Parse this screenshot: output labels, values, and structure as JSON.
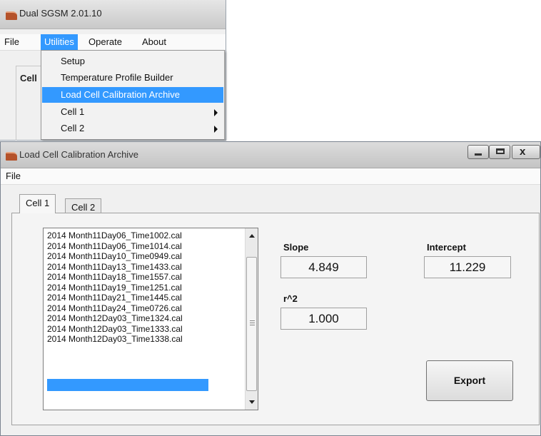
{
  "main_window": {
    "title": "Dual SGSM 2.01.10",
    "menu": [
      "File",
      "Utilities",
      "Operate",
      "About"
    ],
    "background_label": "Cell",
    "utilities_menu": [
      {
        "label": "Setup",
        "submenu": false
      },
      {
        "label": "Temperature Profile Builder",
        "submenu": false
      },
      {
        "label": "Load Cell Calibration Archive",
        "submenu": false,
        "highlighted": true
      },
      {
        "label": "Cell 1",
        "submenu": true
      },
      {
        "label": "Cell 2",
        "submenu": true
      }
    ]
  },
  "archive_window": {
    "title": "Load Cell Calibration Archive",
    "menu": [
      "File"
    ],
    "tabs": [
      "Cell 1",
      "Cell 2"
    ],
    "files": [
      "2014 Month11Day06_Time1002.cal",
      "2014 Month11Day06_Time1014.cal",
      "2014 Month11Day10_Time0949.cal",
      "2014 Month11Day13_Time1433.cal",
      "2014 Month11Day18_Time1557.cal",
      "2014 Month11Day19_Time1251.cal",
      "2014 Month11Day21_Time1445.cal",
      "2014 Month11Day24_Time0726.cal",
      "2014 Month12Day03_Time1324.cal",
      "2014 Month12Day03_Time1333.cal",
      "2014 Month12Day03_Time1338.cal"
    ],
    "slope_label": "Slope",
    "slope_value": "4.849",
    "intercept_label": "Intercept",
    "intercept_value": "11.229",
    "r2_label": "r^2",
    "r2_value": "1.000",
    "export_label": "Export"
  },
  "colors": {
    "highlight": "#3399ff",
    "icon": "#b5522a"
  },
  "icons": [
    "app-icon",
    "minimize-icon",
    "maximize-icon",
    "close-icon",
    "chevron-right-icon",
    "scroll-up-icon",
    "scroll-down-icon"
  ]
}
